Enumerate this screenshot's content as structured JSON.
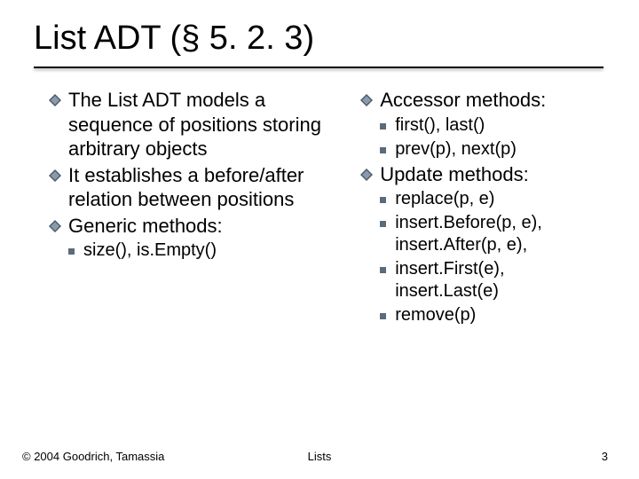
{
  "title": "List ADT (§ 5. 2. 3)",
  "left": {
    "p1": "The List ADT models a sequence of positions storing arbitrary objects",
    "p2": "It establishes a before/after relation between positions",
    "p3": "Generic methods:",
    "p3a": "size(), is.Empty()"
  },
  "right": {
    "a": "Accessor methods:",
    "a1": "first(), last()",
    "a2": "prev(p), next(p)",
    "u": "Update methods:",
    "u1": "replace(p, e)",
    "u2": "insert.Before(p, e), insert.After(p, e),",
    "u3": "insert.First(e), insert.Last(e)",
    "u4": "remove(p)"
  },
  "footer": {
    "left": "© 2004 Goodrich, Tamassia",
    "center": "Lists",
    "right": "3"
  }
}
